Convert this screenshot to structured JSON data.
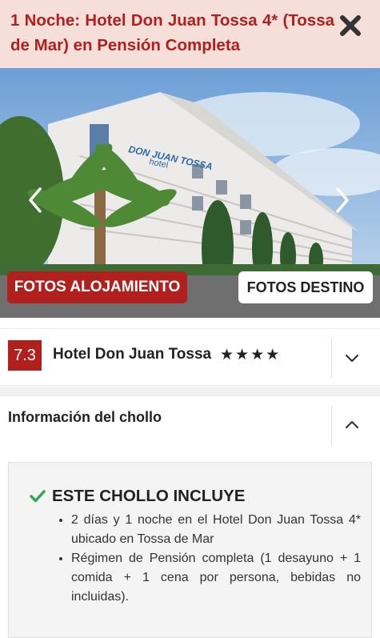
{
  "header": {
    "title": "1 Noche: Hotel Don Juan Tossa 4* (Tossa de Mar) en Pensión Completa"
  },
  "gallery": {
    "building_sign": "DON JUAN TOSSA",
    "building_sign_sub": "hotel",
    "btn_alojamiento": "FOTOS ALOJAMIENTO",
    "btn_destino": "FOTOS DESTINO"
  },
  "hotel": {
    "rating": "7.3",
    "name": "Hotel Don Juan Tossa",
    "stars": "★★★★",
    "star_count": 4
  },
  "info": {
    "title": "Información del chollo"
  },
  "includes": {
    "title": "ESTE CHOLLO INCLUYE",
    "items": [
      "2 días y 1 noche en el Hotel Don Juan Tossa 4* ubicado en Tossa de Mar",
      "Régimen de Pensión completa (1 desayuno + 1 comida + 1 cena por persona, bebidas no incluidas)."
    ]
  },
  "colors": {
    "brand_red": "#b0211d",
    "header_bg": "#f7dfd9",
    "check_green": "#2fa84f"
  }
}
